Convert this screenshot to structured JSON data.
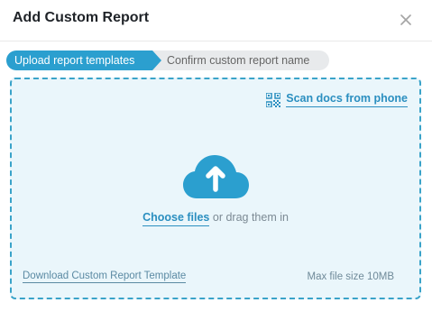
{
  "modal": {
    "title": "Add Custom Report",
    "close_icon": "close-icon"
  },
  "steps": [
    {
      "label": "Upload report templates",
      "state": "active"
    },
    {
      "label": "Confirm custom report name",
      "state": "inactive"
    }
  ],
  "dropzone": {
    "scan_label": "Scan docs from phone",
    "scan_icon": "qr-code-icon",
    "upload_icon": "cloud-upload-icon",
    "choose_files_label": "Choose files",
    "drag_text": " or drag them in",
    "download_template_label": "Download Custom Report Template",
    "max_file_size": "Max file size 10MB"
  },
  "colors": {
    "accent": "#2b9fcf",
    "dropzone_bg": "#eaf6fb",
    "dropzone_border": "#3aa3c9",
    "inactive_step": "#e8eaec"
  }
}
